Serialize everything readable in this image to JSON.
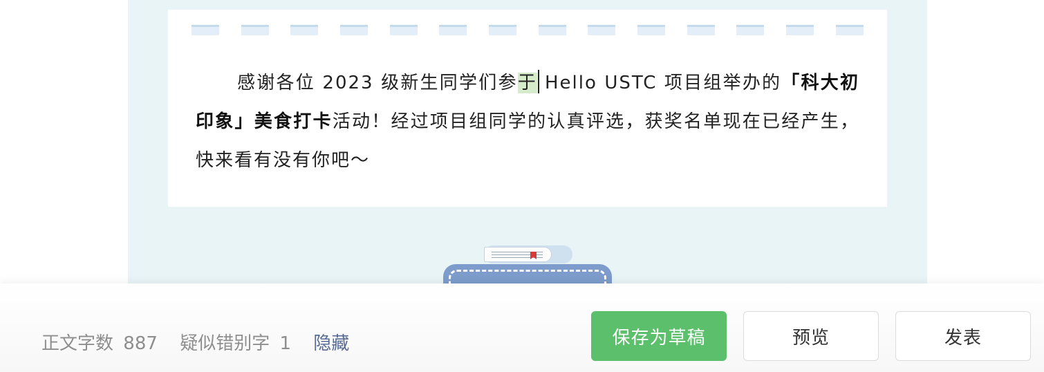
{
  "article": {
    "p1_a": "感谢各位 2023 级新生同学们参",
    "p1_highlight": "于",
    "p1_b": "Hello USTC 项目组举办的",
    "p1_bold": "「科大初印象」美食打卡",
    "p1_c": "活动！经过项目组同学的认真评选，获奖名单现在已经产生，快来看有没有你吧～"
  },
  "footer": {
    "word_count_label": "正文字数",
    "word_count_value": "887",
    "typo_label": "疑似错别字",
    "typo_value": "1",
    "hide_link": "隐藏",
    "save_draft_button": "保存为草稿",
    "preview_button": "预览",
    "publish_button": "发表"
  },
  "colors": {
    "primary_green": "#5bbf6b",
    "link_blue": "#576b95",
    "editor_bg": "#e8f4f6"
  }
}
